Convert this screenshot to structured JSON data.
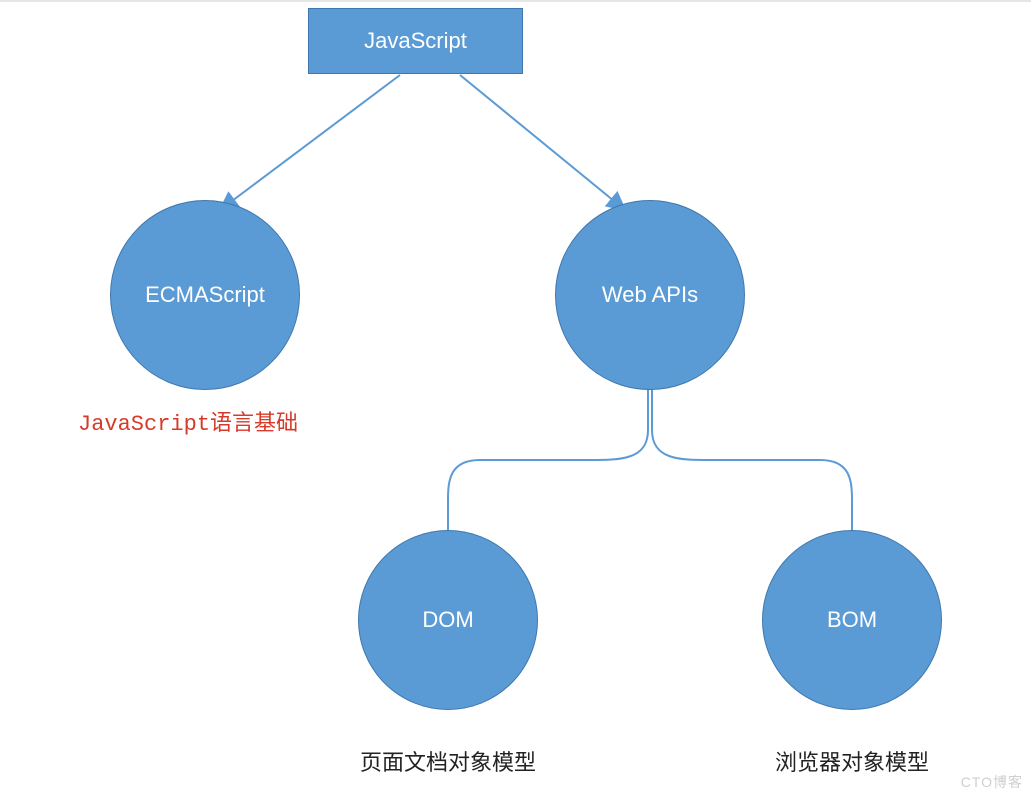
{
  "root": {
    "label": "JavaScript"
  },
  "level1": {
    "left": {
      "label": "ECMAScript",
      "caption": "JavaScript语言基础"
    },
    "right": {
      "label": "Web APIs"
    }
  },
  "level2": {
    "dom": {
      "label": "DOM",
      "caption": "页面文档对象模型"
    },
    "bom": {
      "label": "BOM",
      "caption": "浏览器对象模型"
    }
  },
  "watermark": "CTO博客",
  "colors": {
    "node": "#5b9bd5",
    "nodeBorder": "#3e77ad",
    "nodeText": "#ffffff",
    "captionRed": "#d63a2a",
    "connector": "#5b9bd5"
  }
}
